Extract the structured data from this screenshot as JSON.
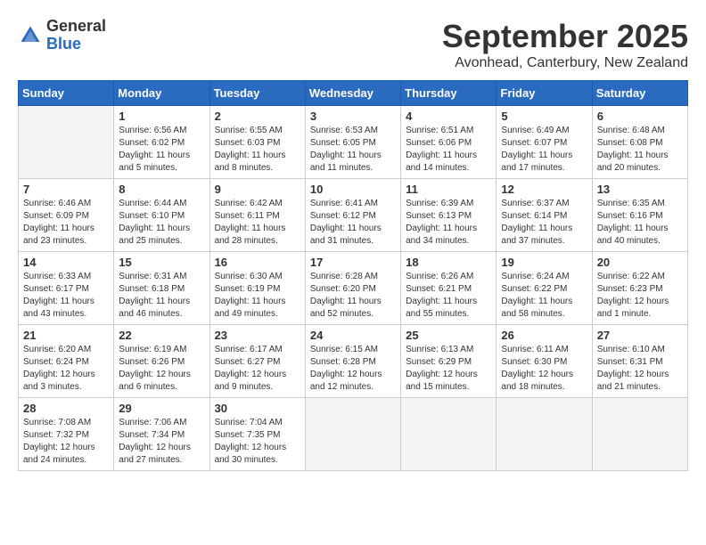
{
  "logo": {
    "general": "General",
    "blue": "Blue"
  },
  "title": "September 2025",
  "location": "Avonhead, Canterbury, New Zealand",
  "days_of_week": [
    "Sunday",
    "Monday",
    "Tuesday",
    "Wednesday",
    "Thursday",
    "Friday",
    "Saturday"
  ],
  "weeks": [
    [
      {
        "day": "",
        "info": ""
      },
      {
        "day": "1",
        "info": "Sunrise: 6:56 AM\nSunset: 6:02 PM\nDaylight: 11 hours\nand 5 minutes."
      },
      {
        "day": "2",
        "info": "Sunrise: 6:55 AM\nSunset: 6:03 PM\nDaylight: 11 hours\nand 8 minutes."
      },
      {
        "day": "3",
        "info": "Sunrise: 6:53 AM\nSunset: 6:05 PM\nDaylight: 11 hours\nand 11 minutes."
      },
      {
        "day": "4",
        "info": "Sunrise: 6:51 AM\nSunset: 6:06 PM\nDaylight: 11 hours\nand 14 minutes."
      },
      {
        "day": "5",
        "info": "Sunrise: 6:49 AM\nSunset: 6:07 PM\nDaylight: 11 hours\nand 17 minutes."
      },
      {
        "day": "6",
        "info": "Sunrise: 6:48 AM\nSunset: 6:08 PM\nDaylight: 11 hours\nand 20 minutes."
      }
    ],
    [
      {
        "day": "7",
        "info": "Sunrise: 6:46 AM\nSunset: 6:09 PM\nDaylight: 11 hours\nand 23 minutes."
      },
      {
        "day": "8",
        "info": "Sunrise: 6:44 AM\nSunset: 6:10 PM\nDaylight: 11 hours\nand 25 minutes."
      },
      {
        "day": "9",
        "info": "Sunrise: 6:42 AM\nSunset: 6:11 PM\nDaylight: 11 hours\nand 28 minutes."
      },
      {
        "day": "10",
        "info": "Sunrise: 6:41 AM\nSunset: 6:12 PM\nDaylight: 11 hours\nand 31 minutes."
      },
      {
        "day": "11",
        "info": "Sunrise: 6:39 AM\nSunset: 6:13 PM\nDaylight: 11 hours\nand 34 minutes."
      },
      {
        "day": "12",
        "info": "Sunrise: 6:37 AM\nSunset: 6:14 PM\nDaylight: 11 hours\nand 37 minutes."
      },
      {
        "day": "13",
        "info": "Sunrise: 6:35 AM\nSunset: 6:16 PM\nDaylight: 11 hours\nand 40 minutes."
      }
    ],
    [
      {
        "day": "14",
        "info": "Sunrise: 6:33 AM\nSunset: 6:17 PM\nDaylight: 11 hours\nand 43 minutes."
      },
      {
        "day": "15",
        "info": "Sunrise: 6:31 AM\nSunset: 6:18 PM\nDaylight: 11 hours\nand 46 minutes."
      },
      {
        "day": "16",
        "info": "Sunrise: 6:30 AM\nSunset: 6:19 PM\nDaylight: 11 hours\nand 49 minutes."
      },
      {
        "day": "17",
        "info": "Sunrise: 6:28 AM\nSunset: 6:20 PM\nDaylight: 11 hours\nand 52 minutes."
      },
      {
        "day": "18",
        "info": "Sunrise: 6:26 AM\nSunset: 6:21 PM\nDaylight: 11 hours\nand 55 minutes."
      },
      {
        "day": "19",
        "info": "Sunrise: 6:24 AM\nSunset: 6:22 PM\nDaylight: 11 hours\nand 58 minutes."
      },
      {
        "day": "20",
        "info": "Sunrise: 6:22 AM\nSunset: 6:23 PM\nDaylight: 12 hours\nand 1 minute."
      }
    ],
    [
      {
        "day": "21",
        "info": "Sunrise: 6:20 AM\nSunset: 6:24 PM\nDaylight: 12 hours\nand 3 minutes."
      },
      {
        "day": "22",
        "info": "Sunrise: 6:19 AM\nSunset: 6:26 PM\nDaylight: 12 hours\nand 6 minutes."
      },
      {
        "day": "23",
        "info": "Sunrise: 6:17 AM\nSunset: 6:27 PM\nDaylight: 12 hours\nand 9 minutes."
      },
      {
        "day": "24",
        "info": "Sunrise: 6:15 AM\nSunset: 6:28 PM\nDaylight: 12 hours\nand 12 minutes."
      },
      {
        "day": "25",
        "info": "Sunrise: 6:13 AM\nSunset: 6:29 PM\nDaylight: 12 hours\nand 15 minutes."
      },
      {
        "day": "26",
        "info": "Sunrise: 6:11 AM\nSunset: 6:30 PM\nDaylight: 12 hours\nand 18 minutes."
      },
      {
        "day": "27",
        "info": "Sunrise: 6:10 AM\nSunset: 6:31 PM\nDaylight: 12 hours\nand 21 minutes."
      }
    ],
    [
      {
        "day": "28",
        "info": "Sunrise: 7:08 AM\nSunset: 7:32 PM\nDaylight: 12 hours\nand 24 minutes."
      },
      {
        "day": "29",
        "info": "Sunrise: 7:06 AM\nSunset: 7:34 PM\nDaylight: 12 hours\nand 27 minutes."
      },
      {
        "day": "30",
        "info": "Sunrise: 7:04 AM\nSunset: 7:35 PM\nDaylight: 12 hours\nand 30 minutes."
      },
      {
        "day": "",
        "info": ""
      },
      {
        "day": "",
        "info": ""
      },
      {
        "day": "",
        "info": ""
      },
      {
        "day": "",
        "info": ""
      }
    ]
  ]
}
